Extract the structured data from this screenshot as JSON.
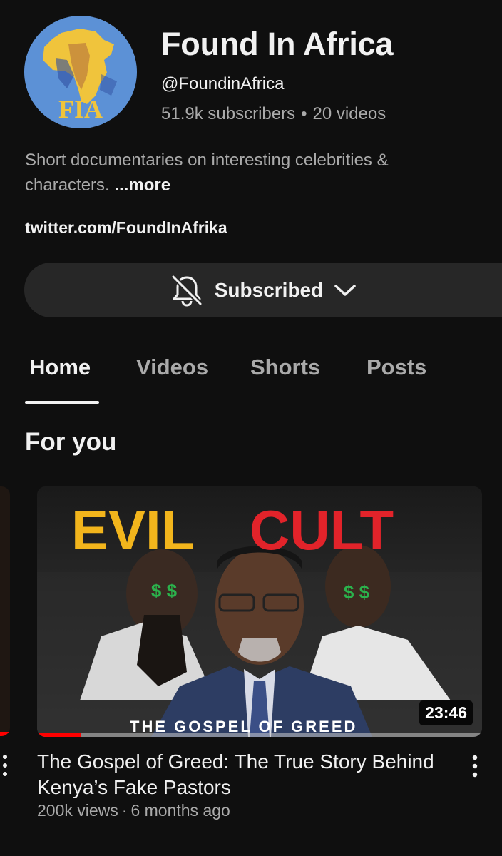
{
  "channel": {
    "name": "Found In Africa",
    "handle": "@FoundinAfrica",
    "subscribers": "51.9k subscribers",
    "separator": "•",
    "videos": "20 videos",
    "description": "Short documentaries on interesting celebrities & characters.",
    "more_label": "...more",
    "link": "twitter.com/FoundInAfrika",
    "avatar_text": "FIA"
  },
  "subscribe_button": {
    "label": "Subscribed",
    "icon": "bell-off-icon",
    "chevron": "chevron-down-icon"
  },
  "tabs": [
    {
      "label": "Home",
      "active": true
    },
    {
      "label": "Videos",
      "active": false
    },
    {
      "label": "Shorts",
      "active": false
    },
    {
      "label": "Posts",
      "active": false
    }
  ],
  "section": {
    "title": "For you"
  },
  "video": {
    "thumbnail_text": {
      "word1": "EVIL",
      "word2": "CULT",
      "subtitle": "THE GOSPEL OF GREED"
    },
    "duration": "23:46",
    "title": "The Gospel of Greed: The True Story Behind Kenya’s Fake Pastors",
    "views": "200k views",
    "separator": "·",
    "age": "6 months ago",
    "watch_progress": 0.1
  },
  "colors": {
    "background": "#0f0f0f",
    "button_bg": "#272727",
    "secondary_text": "#aaaaaa",
    "progress": "#ff0000",
    "evil_yellow": "#f2b51c",
    "cult_red": "#e2232a"
  }
}
